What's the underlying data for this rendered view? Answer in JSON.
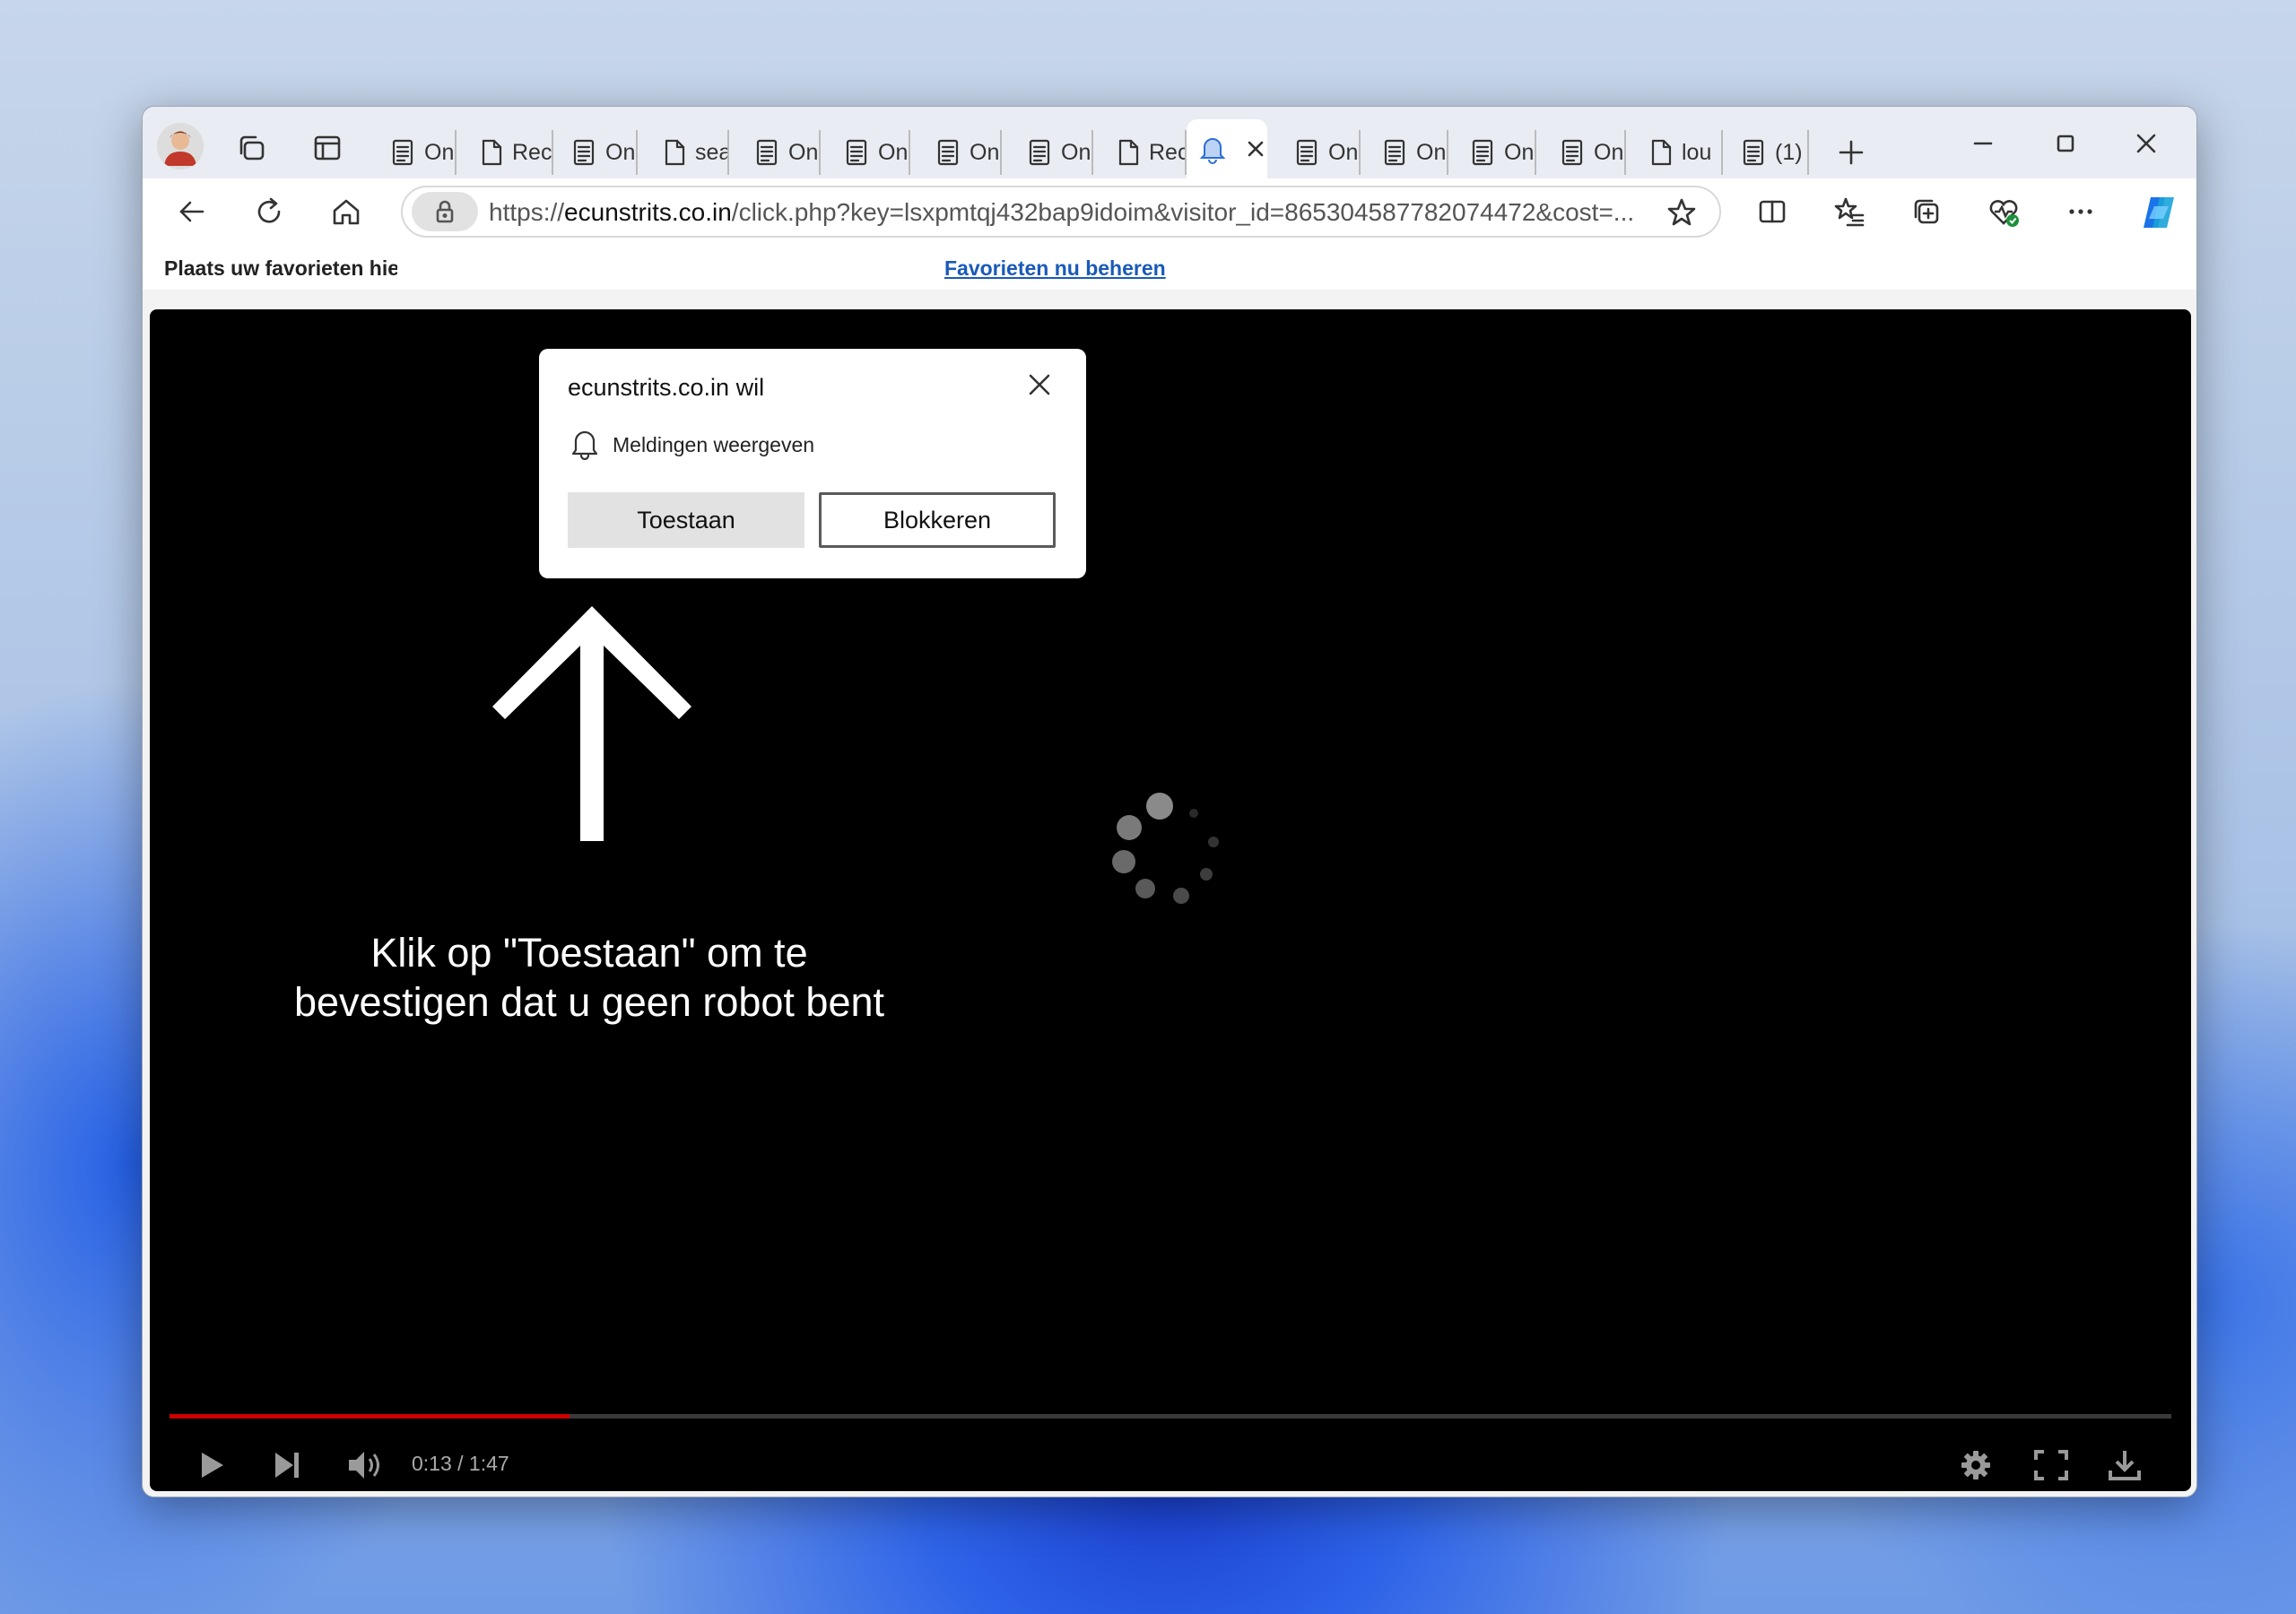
{
  "browser": {
    "tabs": [
      {
        "label": "On",
        "icon": "document-icon"
      },
      {
        "label": "Rec",
        "icon": "page-icon"
      },
      {
        "label": "On",
        "icon": "document-icon"
      },
      {
        "label": "sea",
        "icon": "page-icon"
      },
      {
        "label": "On",
        "icon": "document-icon"
      },
      {
        "label": "On",
        "icon": "document-icon"
      },
      {
        "label": "On",
        "icon": "document-icon"
      },
      {
        "label": "On",
        "icon": "document-icon"
      },
      {
        "label": "Rec",
        "icon": "page-icon"
      },
      {
        "label": "",
        "icon": "bell-icon",
        "active": true
      },
      {
        "label": "On",
        "icon": "document-icon"
      },
      {
        "label": "On",
        "icon": "document-icon"
      },
      {
        "label": "On",
        "icon": "document-icon"
      },
      {
        "label": "On",
        "icon": "document-icon"
      },
      {
        "label": "lou",
        "icon": "page-icon"
      },
      {
        "label": "(1)",
        "icon": "document-icon"
      }
    ],
    "address": {
      "scheme": "https://",
      "host": "ecunstrits.co.in",
      "path": "/click.php?key=lsxpmtqj432bap9idoim&visitor_id=865304587782074472&cost=..."
    },
    "favorites_bar": {
      "text": "Plaats uw favorieten hier",
      "link": "Favorieten nu beheren"
    }
  },
  "popup": {
    "title": "ecunstrits.co.in wil",
    "permission": "Meldingen weergeven",
    "allow": "Toestaan",
    "block": "Blokkeren"
  },
  "page": {
    "message": "Klik op \"Toestaan\" om te bevestigen dat u geen robot bent"
  },
  "player": {
    "time": "0:13 / 1:47",
    "progress": 0.2,
    "accent_color": "#cc0000"
  }
}
